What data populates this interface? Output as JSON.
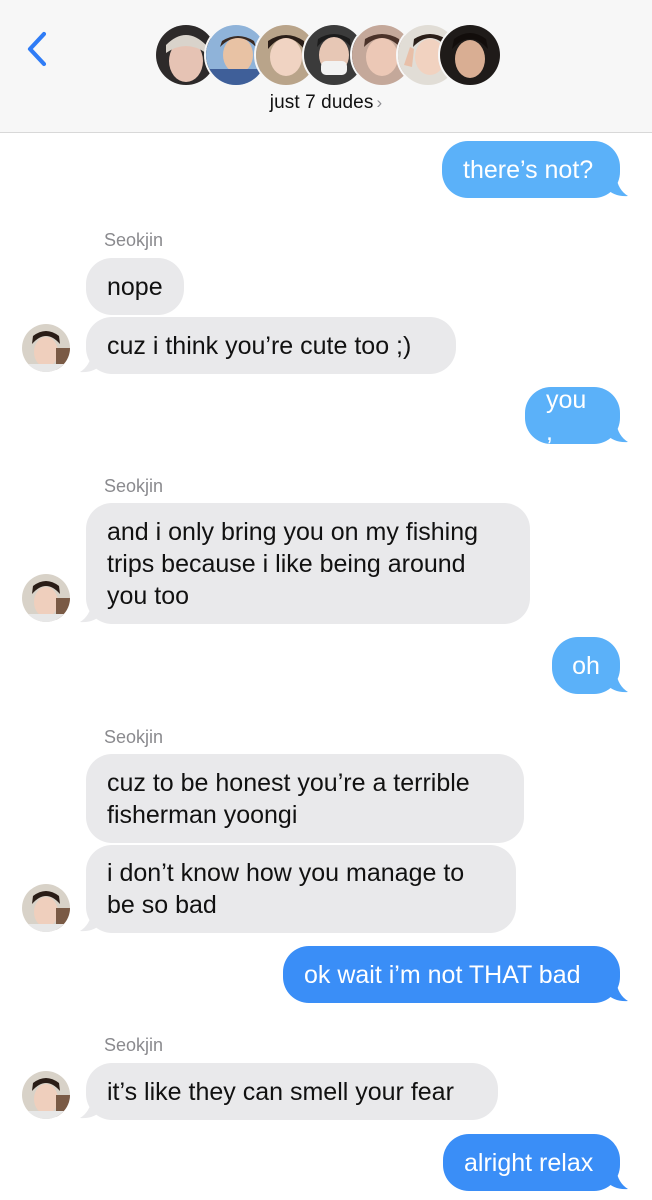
{
  "header": {
    "group_name": "just 7 dudes",
    "chevron": "›",
    "back_icon": "chevron-left-icon",
    "member_count": 7
  },
  "colors": {
    "accent": "#3a8ef7",
    "outgoing_light": "#5bb1f9",
    "incoming": "#e9e9eb",
    "header_bg": "#f7f7f7"
  },
  "messages": {
    "m1": "there’s not?",
    "s1": "Seokjin",
    "m2": "nope",
    "m3": "cuz i think you’re cute too ;)",
    "m4": "you ,",
    "s2": "Seokjin",
    "m5a": "and i only bring you on my fishing",
    "m5b": "trips because i like being around",
    "m5c": "you too",
    "m6": "oh",
    "s3": "Seokjin",
    "m7a": "cuz to be honest you’re a terrible",
    "m7b": "fisherman yoongi",
    "m8a": "i don’t know how you manage to",
    "m8b": "be so bad",
    "m9": "ok wait i’m not THAT bad",
    "s4": "Seokjin",
    "m10": "it’s like they can smell your fear",
    "m11": "alright relax"
  }
}
